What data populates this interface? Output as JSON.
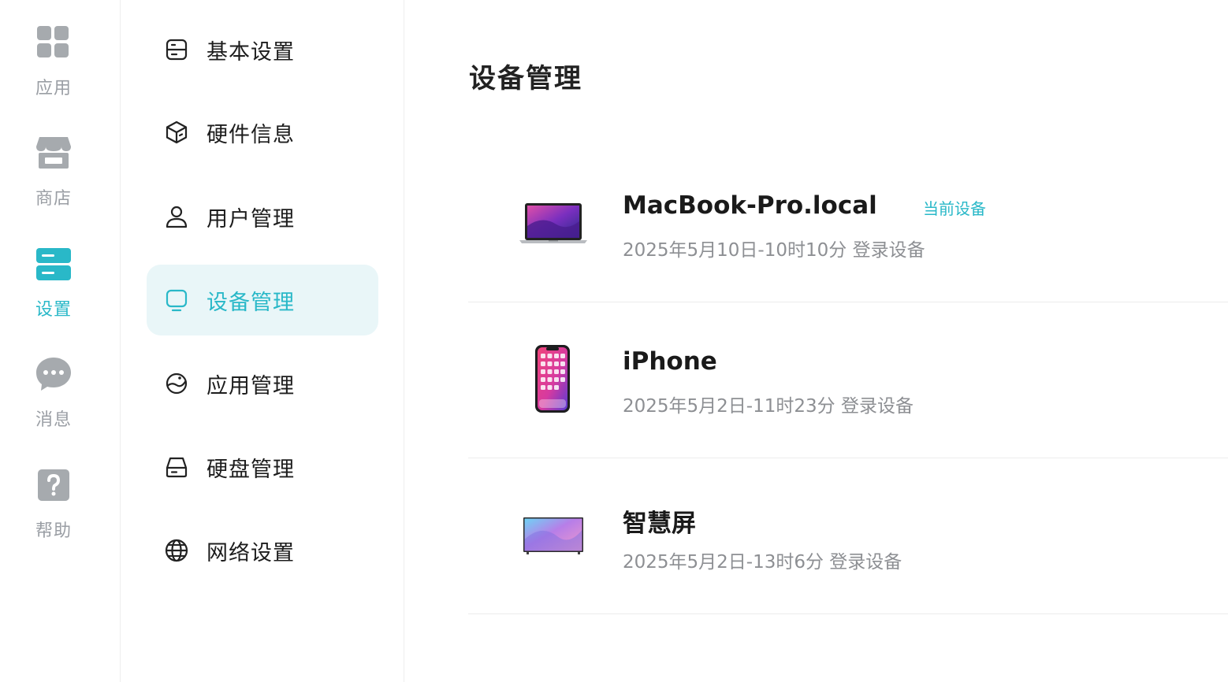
{
  "rail": {
    "items": [
      {
        "label": "应用",
        "icon": "grid-icon"
      },
      {
        "label": "商店",
        "icon": "store-icon"
      },
      {
        "label": "设置",
        "icon": "settings-drawer-icon",
        "active": true
      },
      {
        "label": "消息",
        "icon": "chat-bubble-icon"
      },
      {
        "label": "帮助",
        "icon": "help-icon"
      }
    ]
  },
  "menu": {
    "items": [
      {
        "label": "基本设置",
        "icon": "basic-settings-icon"
      },
      {
        "label": "硬件信息",
        "icon": "cube-icon"
      },
      {
        "label": "用户管理",
        "icon": "user-icon"
      },
      {
        "label": "设备管理",
        "icon": "monitor-icon",
        "active": true
      },
      {
        "label": "应用管理",
        "icon": "planet-icon"
      },
      {
        "label": "硬盘管理",
        "icon": "hard-drive-icon"
      },
      {
        "label": "网络设置",
        "icon": "globe-icon"
      }
    ]
  },
  "main": {
    "title": "设备管理",
    "devices": [
      {
        "name": "MacBook-Pro.local",
        "badge": "当前设备",
        "login": "2025年5月10日-10时10分 登录设备",
        "type": "laptop"
      },
      {
        "name": "iPhone",
        "login": "2025年5月2日-11时23分 登录设备",
        "type": "phone"
      },
      {
        "name": "智慧屏",
        "login": "2025年5月2日-13时6分 登录设备",
        "type": "tv"
      }
    ]
  },
  "colors": {
    "accent": "#29b8c8",
    "active_bg": "#e9f6f8",
    "muted_text": "#8d8f93",
    "rail_icon": "#a6aaae"
  }
}
